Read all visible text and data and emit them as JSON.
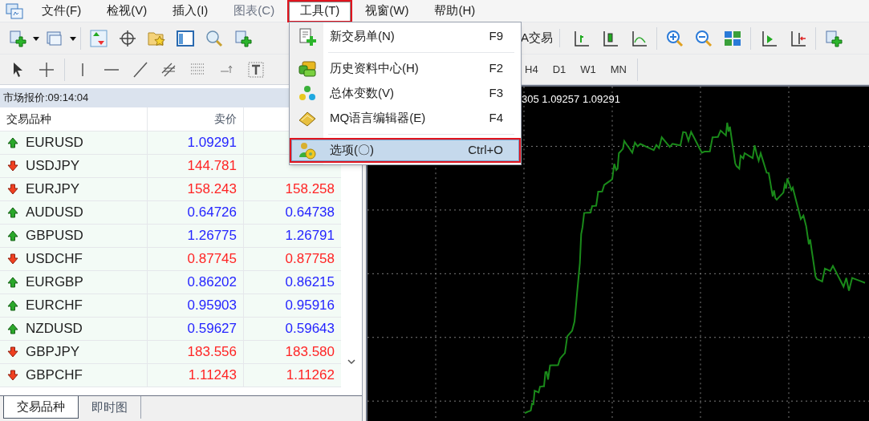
{
  "menu_bar": [
    {
      "label": "文件(F)",
      "disabled": false,
      "selected": false,
      "highlighted": false
    },
    {
      "label": "检视(V)",
      "disabled": false,
      "selected": false,
      "highlighted": false
    },
    {
      "label": "插入(I)",
      "disabled": false,
      "selected": false,
      "highlighted": false
    },
    {
      "label": "图表(C)",
      "disabled": true,
      "selected": false,
      "highlighted": false
    },
    {
      "label": "工具(T)",
      "disabled": false,
      "selected": true,
      "highlighted": true
    },
    {
      "label": "视窗(W)",
      "disabled": false,
      "selected": false,
      "highlighted": false
    },
    {
      "label": "帮助(H)",
      "disabled": false,
      "selected": false,
      "highlighted": false
    }
  ],
  "toolbar": {
    "auto_trading_label": "A交易"
  },
  "timeframes": [
    "H4",
    "D1",
    "W1",
    "MN"
  ],
  "tools_menu": [
    {
      "kind": "item",
      "label": "新交易单(N)",
      "shortcut": "F9",
      "selected": false,
      "highlighted": false
    },
    {
      "kind": "separator"
    },
    {
      "kind": "item",
      "label": "历史资料中心(H)",
      "shortcut": "F2",
      "selected": false,
      "highlighted": false
    },
    {
      "kind": "item",
      "label": "总体变数(V)",
      "shortcut": "F3",
      "selected": false,
      "highlighted": false
    },
    {
      "kind": "item",
      "label": "MQ语言编辑器(E)",
      "shortcut": "F4",
      "selected": false,
      "highlighted": false
    },
    {
      "kind": "separator"
    },
    {
      "kind": "item",
      "label": "选项(〇)",
      "shortcut": "Ctrl+O",
      "selected": true,
      "highlighted": true
    }
  ],
  "market_watch": {
    "title": "市场报价:09:14:04",
    "columns": [
      "交易品种",
      "卖价"
    ],
    "rows": [
      {
        "symbol": "EURUSD",
        "rising": true,
        "bid": "1.09291"
      },
      {
        "symbol": "USDJPY",
        "rising": false,
        "bid": "144.781"
      },
      {
        "symbol": "EURJPY",
        "rising": false,
        "bid": "158.243",
        "ask": "158.258"
      },
      {
        "symbol": "AUDUSD",
        "rising": true,
        "bid": "0.64726",
        "ask": "0.64738"
      },
      {
        "symbol": "GBPUSD",
        "rising": true,
        "bid": "1.26775",
        "ask": "1.26791"
      },
      {
        "symbol": "USDCHF",
        "rising": false,
        "bid": "0.87745",
        "ask": "0.87758"
      },
      {
        "symbol": "EURGBP",
        "rising": true,
        "bid": "0.86202",
        "ask": "0.86215"
      },
      {
        "symbol": "EURCHF",
        "rising": true,
        "bid": "0.95903",
        "ask": "0.95916"
      },
      {
        "symbol": "NZDUSD",
        "rising": true,
        "bid": "0.59627",
        "ask": "0.59643"
      },
      {
        "symbol": "GBPJPY",
        "rising": false,
        "bid": "183.556",
        "ask": "183.580"
      },
      {
        "symbol": "GBPCHF",
        "rising": false,
        "bid": "1.11243",
        "ask": "1.11262"
      }
    ],
    "tabs": [
      {
        "label": "交易品种",
        "selected": true
      },
      {
        "label": "即时图",
        "selected": false
      }
    ]
  },
  "chart": {
    "header": "305 1.09257 1.09291"
  }
}
